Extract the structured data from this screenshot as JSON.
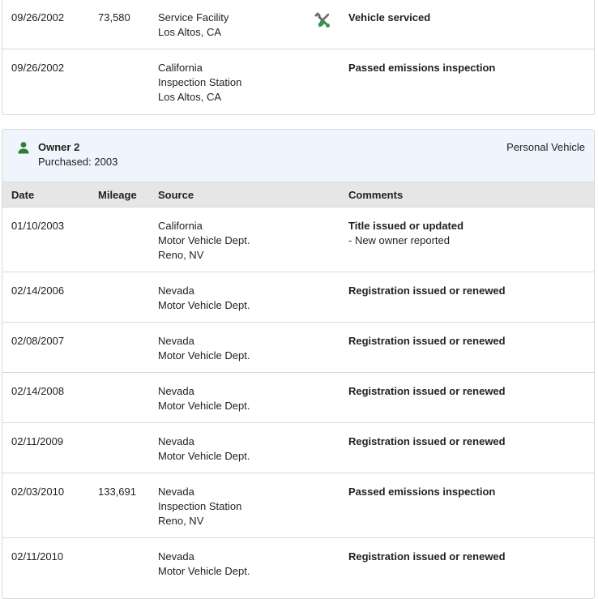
{
  "previous_records": [
    {
      "date": "09/26/2002",
      "mileage": "73,580",
      "source": [
        "Service Facility",
        "Los Altos, CA"
      ],
      "icon": "wrench-screwdriver-icon",
      "comment_title": "Vehicle serviced",
      "comment_details": []
    },
    {
      "date": "09/26/2002",
      "mileage": "",
      "source": [
        "California",
        "Inspection Station",
        "Los Altos, CA"
      ],
      "icon": "",
      "comment_title": "Passed emissions inspection",
      "comment_details": []
    }
  ],
  "owner": {
    "title": "Owner 2",
    "purchased": "Purchased: 2003",
    "vehicle_type": "Personal Vehicle",
    "icon": "person-icon",
    "icon_color": "#2e7d32"
  },
  "table": {
    "headers": {
      "date": "Date",
      "mileage": "Mileage",
      "source": "Source",
      "comments": "Comments"
    },
    "rows": [
      {
        "date": "01/10/2003",
        "mileage": "",
        "source": [
          "California",
          "Motor Vehicle Dept.",
          "Reno, NV"
        ],
        "comment_title": "Title issued or updated",
        "comment_details": [
          "- New owner reported"
        ]
      },
      {
        "date": "02/14/2006",
        "mileage": "",
        "source": [
          "Nevada",
          "Motor Vehicle Dept."
        ],
        "comment_title": "Registration issued or renewed",
        "comment_details": []
      },
      {
        "date": "02/08/2007",
        "mileage": "",
        "source": [
          "Nevada",
          "Motor Vehicle Dept."
        ],
        "comment_title": "Registration issued or renewed",
        "comment_details": []
      },
      {
        "date": "02/14/2008",
        "mileage": "",
        "source": [
          "Nevada",
          "Motor Vehicle Dept."
        ],
        "comment_title": "Registration issued or renewed",
        "comment_details": []
      },
      {
        "date": "02/11/2009",
        "mileage": "",
        "source": [
          "Nevada",
          "Motor Vehicle Dept."
        ],
        "comment_title": "Registration issued or renewed",
        "comment_details": []
      },
      {
        "date": "02/03/2010",
        "mileage": "133,691",
        "source": [
          "Nevada",
          "Inspection Station",
          "Reno, NV"
        ],
        "comment_title": "Passed emissions inspection",
        "comment_details": []
      },
      {
        "date": "02/11/2010",
        "mileage": "",
        "source": [
          "Nevada",
          "Motor Vehicle Dept."
        ],
        "comment_title": "Registration issued or renewed",
        "comment_details": []
      }
    ]
  }
}
